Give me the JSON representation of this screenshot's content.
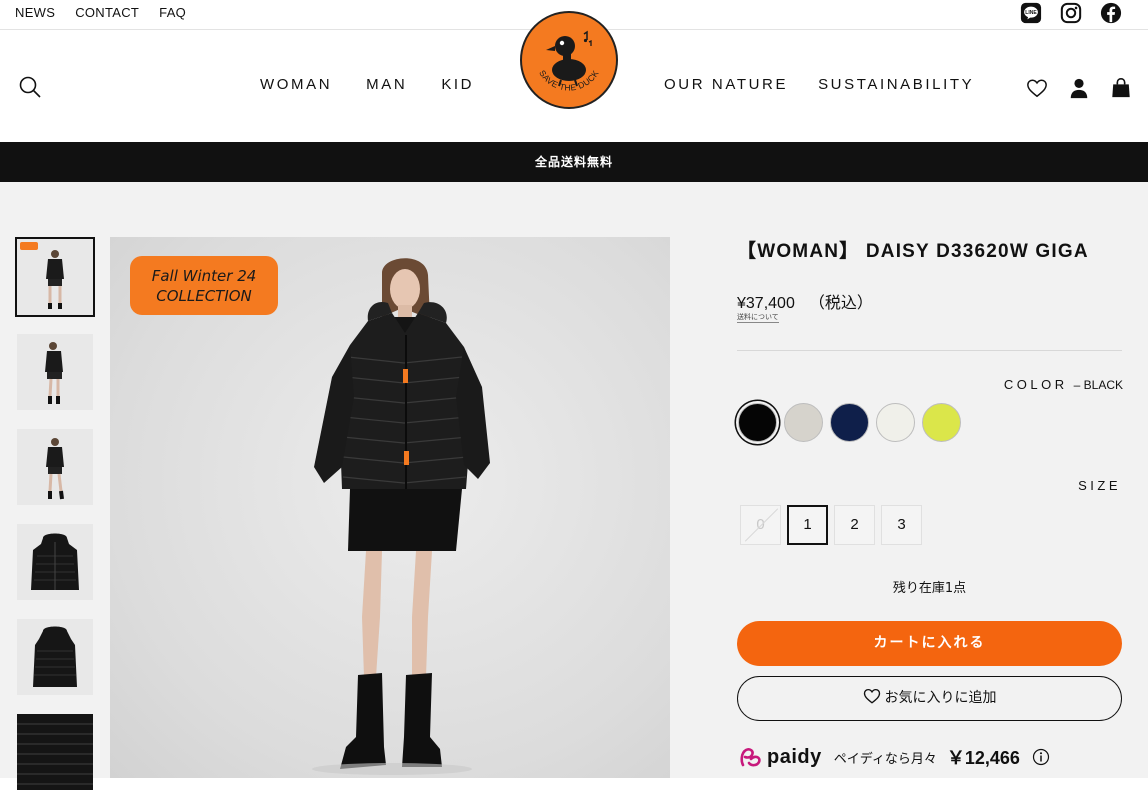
{
  "utility_bar": {
    "links": [
      "NEWS",
      "CONTACT",
      "FAQ"
    ],
    "social_icons": [
      "line-icon",
      "instagram-icon",
      "facebook-icon"
    ]
  },
  "header": {
    "nav_left": [
      "WOMAN",
      "MAN",
      "KID"
    ],
    "nav_right": [
      "OUR NATURE",
      "SUSTAINABILITY"
    ],
    "logo_text": "SAVE THE DUCK",
    "icons": [
      "search-icon",
      "heart-icon",
      "user-icon",
      "bag-icon"
    ]
  },
  "banner": {
    "text": "全品送料無料"
  },
  "gallery": {
    "thumbnail_count": 6,
    "badge_line1": "Fall Winter 24",
    "badge_line2": "COLLECTION"
  },
  "product": {
    "title": "【WOMAN】 DAISY D33620W GIGA",
    "price": "¥37,400",
    "tax_note": "（税込）",
    "shipping_link": "送料について",
    "color_label": "COLOR",
    "color_value": "– BLACK",
    "colors": [
      "#050505",
      "#d6d3cc",
      "#0f1f4a",
      "#f0f0ea",
      "#dbe64a"
    ],
    "size_label": "SIZE",
    "sizes": [
      "0",
      "1",
      "2",
      "3"
    ],
    "selected_size": "1",
    "stock_text": "残り在庫1点",
    "cart_button": "カートに入れる",
    "favorite_button": "お気に入りに追加",
    "paidy_brand": "paidy",
    "paidy_text": "ペイディなら月々",
    "paidy_amount": "￥12,466"
  },
  "colors": {
    "accent": "#f4650f",
    "logo_orange": "#f47a20",
    "banner_bg": "#111111"
  }
}
